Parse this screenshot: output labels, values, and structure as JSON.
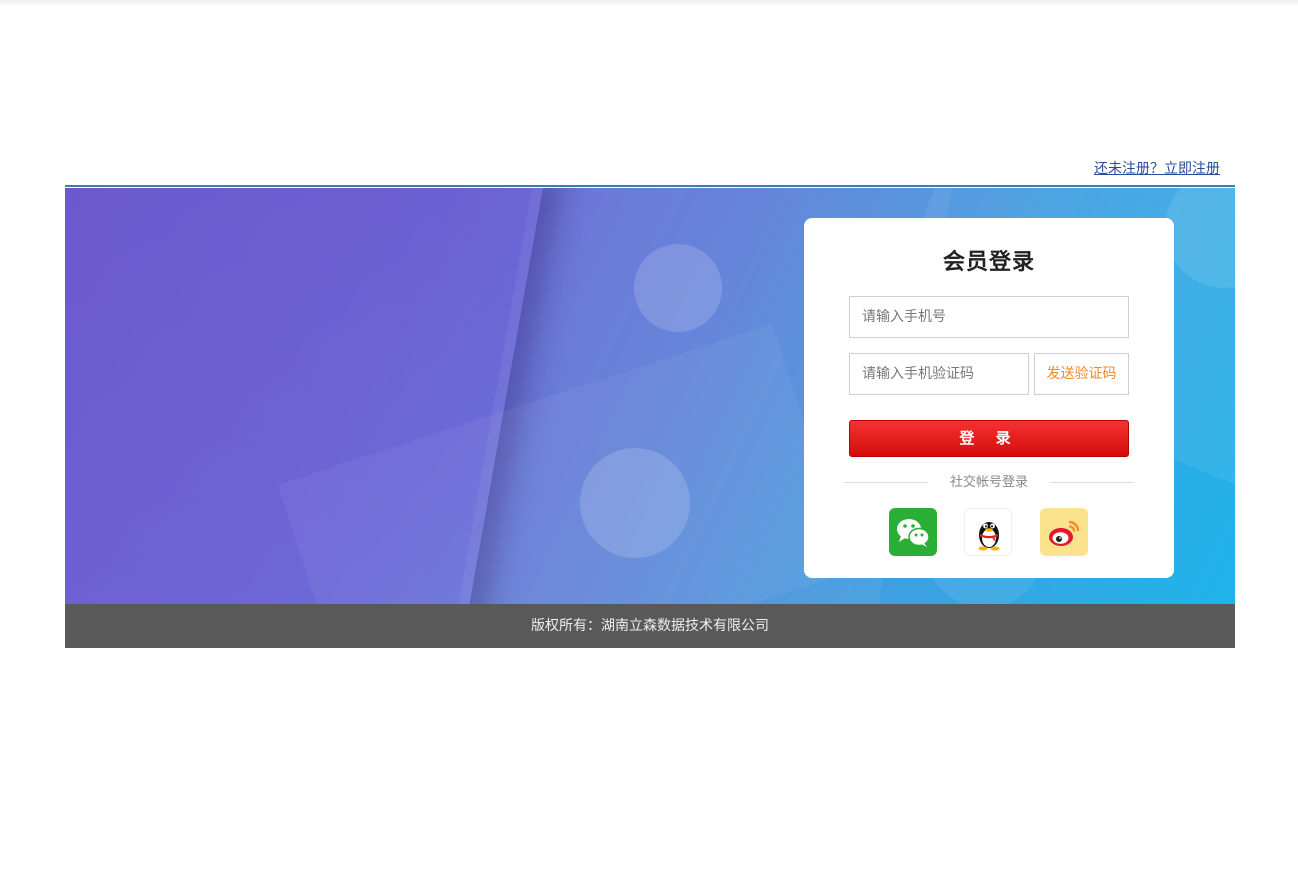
{
  "header": {
    "register_link": "还未注册？立即注册"
  },
  "login": {
    "title": "会员登录",
    "phone_placeholder": "请输入手机号",
    "code_placeholder": "请输入手机验证码",
    "send_code_label": "发送验证码",
    "submit_label": "登 录",
    "social_label": "社交帐号登录",
    "social_icons": [
      "wechat-icon",
      "qq-icon",
      "weibo-icon"
    ]
  },
  "footer": {
    "copyright": "版权所有：湖南立森数据技术有限公司"
  },
  "colors": {
    "accent_red": "#e01010",
    "link_blue": "#2a4a9c",
    "send_code_orange": "#f08a2a",
    "footer_bg": "#595959"
  }
}
